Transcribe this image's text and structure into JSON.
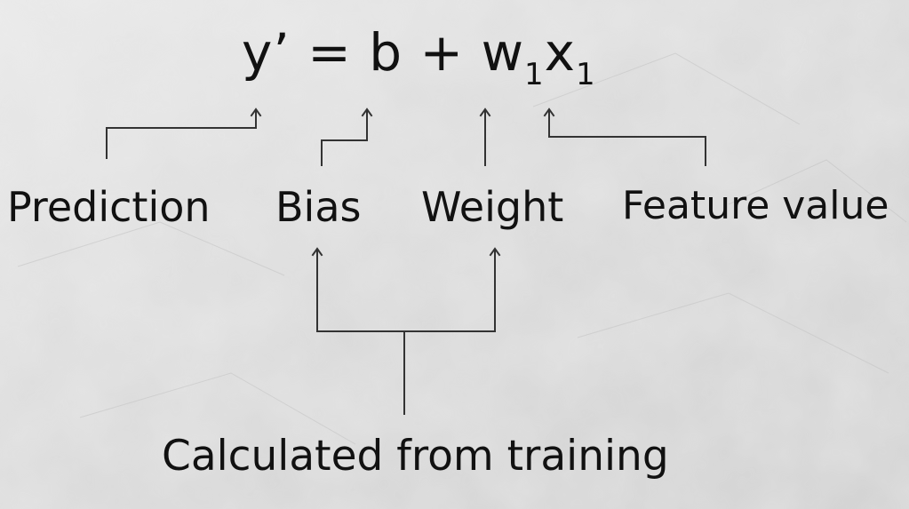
{
  "equation": {
    "lhs": "y’",
    "equals": "=",
    "bias": "b",
    "plus": "+",
    "weight": "w",
    "weight_sub": "1",
    "feature": "x",
    "feature_sub": "1"
  },
  "labels": {
    "prediction": "Prediction",
    "bias": "Bias",
    "weight": "Weight",
    "feature_value": "Feature value",
    "calculated": "Calculated from training"
  },
  "colors": {
    "background": "#dcdcdc",
    "text": "#111111",
    "line": "#333333"
  }
}
